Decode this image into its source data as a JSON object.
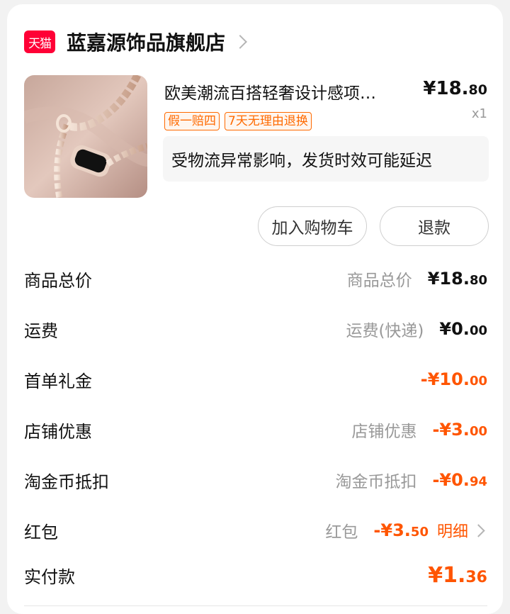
{
  "shop": {
    "logo_text": "天猫",
    "name": "蓝嘉源饰品旗舰店"
  },
  "product": {
    "title": "欧美潮流百搭轻奢设计感项…",
    "price_currency": "¥",
    "price_int": "18.",
    "price_cents": "80",
    "quantity": "x1",
    "tags": [
      "假一赔四",
      "7天无理由退换"
    ],
    "notice": "受物流异常影响，发货时效可能延迟"
  },
  "actions": {
    "add_to_cart": "加入购物车",
    "refund": "退款"
  },
  "summary": {
    "goods_total": {
      "label": "商品总价",
      "sub": "商品总价",
      "currency": "¥",
      "int": "18.",
      "cents": "80"
    },
    "shipping": {
      "label": "运费",
      "sub": "运费(快递)",
      "currency": "¥",
      "int": "0.",
      "cents": "00"
    },
    "first_order_gift": {
      "label": "首单礼金",
      "currency": "-¥",
      "int": "10.",
      "cents": "00"
    },
    "shop_discount": {
      "label": "店铺优惠",
      "sub": "店铺优惠",
      "currency": "-¥",
      "int": "3.",
      "cents": "00"
    },
    "taojinbi": {
      "label": "淘金币抵扣",
      "sub": "淘金币抵扣",
      "currency": "-¥",
      "int": "0.",
      "cents": "94"
    },
    "red_packet": {
      "label": "红包",
      "sub": "红包",
      "currency": "-¥",
      "int": "3.",
      "cents": "50",
      "detail": "明细"
    },
    "paid": {
      "label": "实付款",
      "currency": "¥",
      "int": "1.",
      "cents": "36"
    }
  },
  "colors": {
    "accent": "#ff5500",
    "tmall_red": "#ff0036",
    "tag_orange": "#ff6a00"
  }
}
